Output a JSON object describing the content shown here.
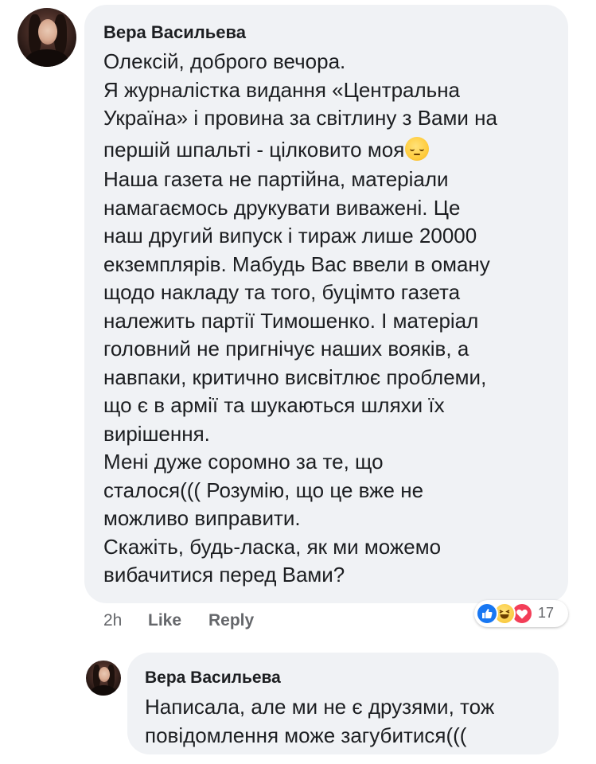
{
  "main_comment": {
    "author": "Вера Васильева",
    "lines": [
      "Олексій, доброго вечора.",
      "Я журналістка видання «Центральна",
      "Україна» і провина за світлину з Вами на",
      "першій шпальті - цілковито моя",
      "Наша газета не партійна, матеріали",
      "намагаємось друкувати виважені. Це",
      "наш другий випуск і тираж лише 20000",
      "екземплярів. Мабудь Вас ввели в оману",
      "щодо накладу та того, буцімто газета",
      "належить партії Тимошенко. І матеріал",
      "головний не пригнічує наших вояків, а",
      "навпаки, критично висвітлює проблеми,",
      "що є в армії та шукаються шляхи їх",
      "вирішення.",
      "Мені дуже соромно за те, що",
      "сталося((( Розумію, що це вже не",
      "можливо виправити.",
      "Скажіть, будь-ласка, як ми можемо",
      "вибачитися перед Вами?"
    ],
    "emoji": "pensive-face-emoji"
  },
  "comment_actions": {
    "time": "2h",
    "like_label": "Like",
    "reply_label": "Reply"
  },
  "reactions": {
    "icons": [
      "like-icon",
      "haha-icon",
      "love-icon"
    ],
    "count": "17",
    "colors": {
      "like": "#1877f2",
      "haha": "#f7c12c",
      "love": "#f33e58"
    }
  },
  "reply_comment": {
    "author": "Вера Васильева",
    "lines": [
      "Написала, але ми не є друзями, тож",
      "повідомлення може загубитися((("
    ]
  },
  "colors": {
    "bubble": "#f0f2f5",
    "text": "#1c1e21",
    "meta": "#65676b"
  }
}
